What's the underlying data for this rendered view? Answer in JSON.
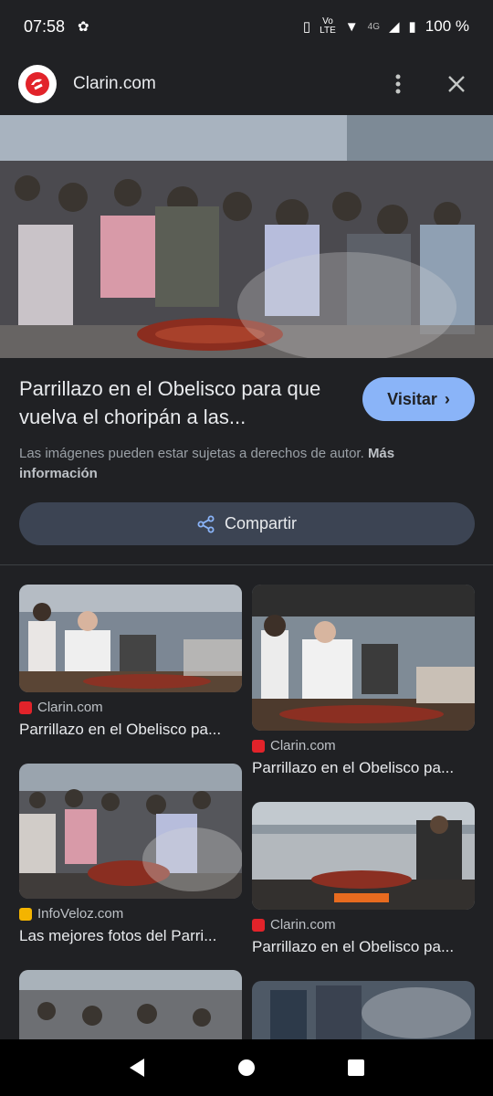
{
  "status": {
    "time": "07:58",
    "network": "LTE",
    "network_label": "Vo",
    "signal": "4G",
    "battery": "100 %"
  },
  "header": {
    "site": "Clarin.com",
    "icons": [
      "clarin-logo",
      "more-vert-icon",
      "close-icon"
    ]
  },
  "result": {
    "title": "Parrillazo en el Obelisco para que vuelva el choripán a las...",
    "visit_label": "Visitar",
    "copyright": "Las imágenes pueden estar sujetas a derechos de autor.",
    "more_info": "Más información",
    "share_label": "Compartir"
  },
  "related": [
    {
      "source": "Clarin.com",
      "caption": "Parrillazo en el Obelisco pa..."
    },
    {
      "source": "Clarin.com",
      "caption": "Parrillazo en el Obelisco pa..."
    },
    {
      "source": "InfoVeloz.com",
      "caption": "Las mejores fotos del Parri..."
    },
    {
      "source": "Clarin.com",
      "caption": "Parrillazo en el Obelisco pa..."
    }
  ],
  "colors": {
    "background": "#202124",
    "accent": "#8ab4f8",
    "share_bg": "#3c4453",
    "clarin_red": "#e2232a",
    "infoveloz_yellow": "#f4b400"
  }
}
